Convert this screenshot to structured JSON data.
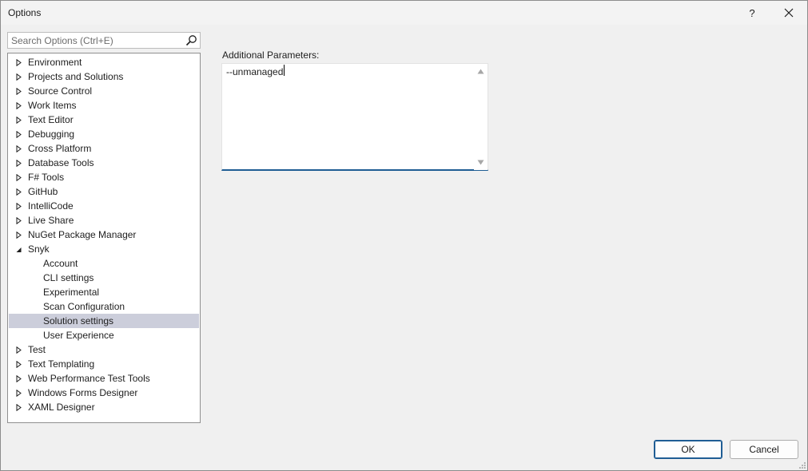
{
  "window": {
    "title": "Options",
    "help_label": "?"
  },
  "search": {
    "placeholder": "Search Options (Ctrl+E)",
    "icon": "search-icon"
  },
  "tree": {
    "items": [
      {
        "label": "Environment",
        "state": "collapsed"
      },
      {
        "label": "Projects and Solutions",
        "state": "collapsed"
      },
      {
        "label": "Source Control",
        "state": "collapsed"
      },
      {
        "label": "Work Items",
        "state": "collapsed"
      },
      {
        "label": "Text Editor",
        "state": "collapsed"
      },
      {
        "label": "Debugging",
        "state": "collapsed"
      },
      {
        "label": "Cross Platform",
        "state": "collapsed"
      },
      {
        "label": "Database Tools",
        "state": "collapsed"
      },
      {
        "label": "F# Tools",
        "state": "collapsed"
      },
      {
        "label": "GitHub",
        "state": "collapsed"
      },
      {
        "label": "IntelliCode",
        "state": "collapsed"
      },
      {
        "label": "Live Share",
        "state": "collapsed"
      },
      {
        "label": "NuGet Package Manager",
        "state": "collapsed"
      },
      {
        "label": "Snyk",
        "state": "expanded"
      },
      {
        "label": "Account",
        "state": "child"
      },
      {
        "label": "CLI settings",
        "state": "child"
      },
      {
        "label": "Experimental",
        "state": "child"
      },
      {
        "label": "Scan Configuration",
        "state": "child"
      },
      {
        "label": "Solution settings",
        "state": "child",
        "selected": true
      },
      {
        "label": "User Experience",
        "state": "child"
      },
      {
        "label": "Test",
        "state": "collapsed"
      },
      {
        "label": "Text Templating",
        "state": "collapsed"
      },
      {
        "label": "Web Performance Test Tools",
        "state": "collapsed"
      },
      {
        "label": "Windows Forms Designer",
        "state": "collapsed"
      },
      {
        "label": "XAML Designer",
        "state": "collapsed"
      }
    ]
  },
  "settings": {
    "additional_params_label": "Additional Parameters:",
    "additional_params_value": "--unmanaged"
  },
  "buttons": {
    "ok_label": "OK",
    "cancel_label": "Cancel"
  },
  "colors": {
    "selection": "#cccedb",
    "accent": "#1f5d94"
  }
}
